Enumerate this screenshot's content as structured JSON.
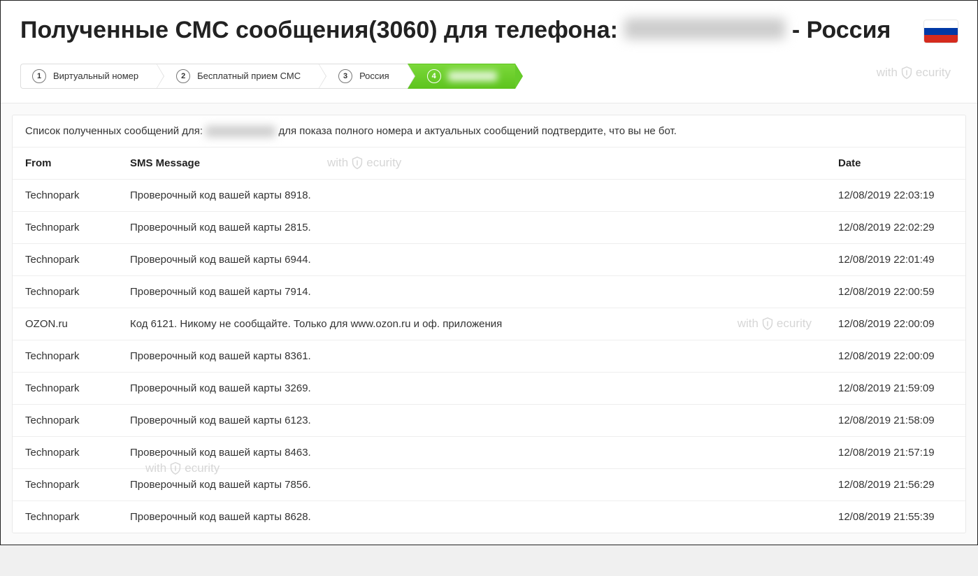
{
  "title_prefix": "Полученные СМС сообщения(3060) для телефона: ",
  "title_dash": " - ",
  "title_suffix": "Россия",
  "watermark": {
    "left": "with",
    "right": "ecurity"
  },
  "breadcrumbs": [
    {
      "num": "1",
      "label": "Виртуальный номер"
    },
    {
      "num": "2",
      "label": "Бесплатный прием СМС"
    },
    {
      "num": "3",
      "label": "Россия"
    },
    {
      "num": "4",
      "label": ""
    }
  ],
  "panel_text_before": "Список полученных сообщений для: ",
  "panel_text_after": " для показа полного номера и актуальных сообщений подтвердите, что вы не бот.",
  "columns": {
    "from": "From",
    "message": "SMS Message",
    "date": "Date"
  },
  "rows": [
    {
      "from": "Technopark",
      "message": "Проверочный код вашей карты 8918.",
      "date": "12/08/2019 22:03:19"
    },
    {
      "from": "Technopark",
      "message": "Проверочный код вашей карты 2815.",
      "date": "12/08/2019 22:02:29"
    },
    {
      "from": "Technopark",
      "message": "Проверочный код вашей карты 6944.",
      "date": "12/08/2019 22:01:49"
    },
    {
      "from": "Technopark",
      "message": "Проверочный код вашей карты 7914.",
      "date": "12/08/2019 22:00:59"
    },
    {
      "from": "OZON.ru",
      "message": "Код 6121. Никому не сообщайте. Только для www.ozon.ru и оф. приложения",
      "date": "12/08/2019 22:00:09"
    },
    {
      "from": "Technopark",
      "message": "Проверочный код вашей карты 8361.",
      "date": "12/08/2019 22:00:09"
    },
    {
      "from": "Technopark",
      "message": "Проверочный код вашей карты 3269.",
      "date": "12/08/2019 21:59:09"
    },
    {
      "from": "Technopark",
      "message": "Проверочный код вашей карты 6123.",
      "date": "12/08/2019 21:58:09"
    },
    {
      "from": "Technopark",
      "message": "Проверочный код вашей карты 8463.",
      "date": "12/08/2019 21:57:19"
    },
    {
      "from": "Technopark",
      "message": "Проверочный код вашей карты 7856.",
      "date": "12/08/2019 21:56:29"
    },
    {
      "from": "Technopark",
      "message": "Проверочный код вашей карты 8628.",
      "date": "12/08/2019 21:55:39"
    }
  ]
}
